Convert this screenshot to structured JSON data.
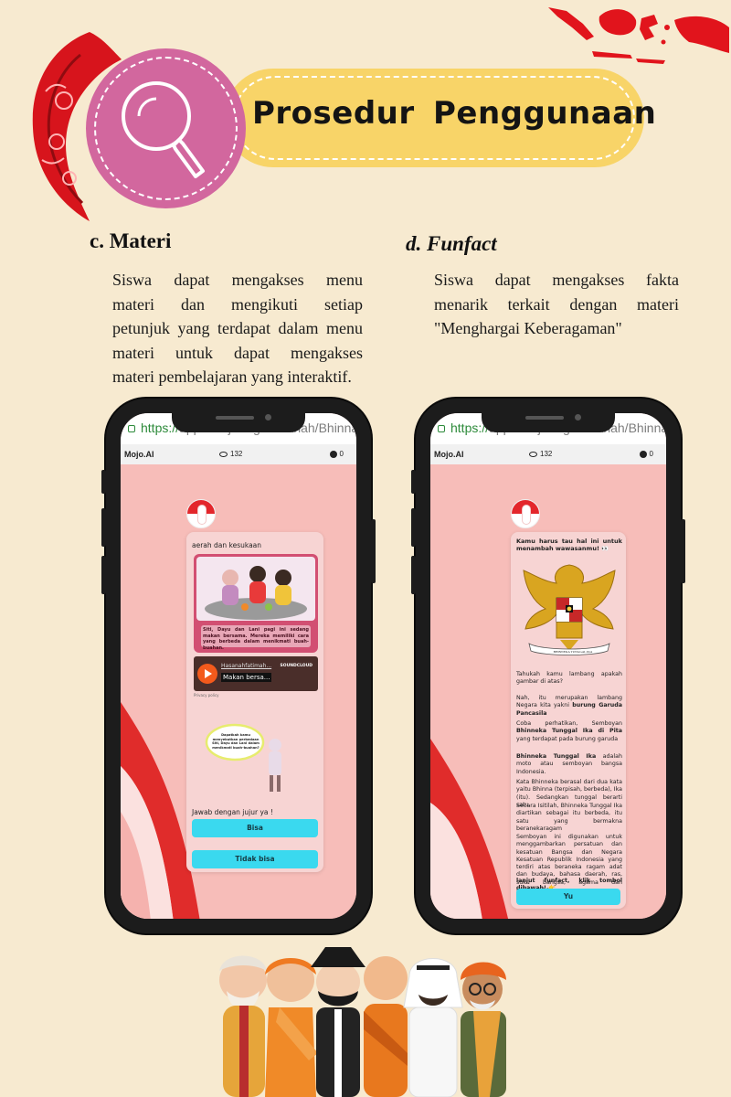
{
  "header": {
    "title": "Prosedur  Penggunaan",
    "search_icon": "magnifier-icon",
    "colors": {
      "banner": "#f8d468",
      "circle": "#d2679e",
      "ornament": "#d7141c",
      "map": "#e1141c"
    }
  },
  "sections": {
    "left": {
      "title": "c. Materi",
      "lines": [
        "Siswa dapat mengakses menu",
        "materi dan mengikuti setiap",
        "petunjuk yang terdapat dalam menu",
        "materi untuk dapat mengakses",
        "materi pembelajaran yang interaktif."
      ]
    },
    "right": {
      "title": "d. Funfact",
      "lines": [
        "Siswa dapat mengakses fakta",
        "menarik terkait dengan materi",
        "\"Menghargai Keberagaman\""
      ]
    }
  },
  "phone_left": {
    "url_https": "https://",
    "url_rest": "app.smojo.org/Hasanah/Bhinna",
    "logo": "Mojo.AI",
    "views": "132",
    "comments": "0",
    "card_caption": "aerah dan kesukaan",
    "comic_text": "Siti, Dayu dan Lani pagi ini sedang makan bersama. Mereka memiliki cara yang berbeda dalam menikmati buah-buahan.",
    "player_link": "Hasanahfatimah...",
    "player_title": "Makan bersa...",
    "player_brand": "SOUNDCLOUD",
    "player_privacy": "Privacy policy",
    "bubble_text": "Dapatkah kamu menyebutkan perbedaan Siti, Dayu dan Lani dalam menikmati buah-buahan?",
    "prompt": "Jawab dengan jujur ya !",
    "btn_yes": "Bisa",
    "btn_no": "Tidak bisa"
  },
  "phone_right": {
    "url_https": "https://",
    "url_rest": "app.smojo.org/Hasanah/Bhinna",
    "logo": "Mojo.AI",
    "views": "132",
    "comments": "0",
    "intro": "Kamu harus tau hal ini untuk menambah wawasanmu! 👀",
    "emblem_motto": "BHINNEKA TUNGGAL IKA",
    "para1": "Tahukah kamu lambang apakah gambar di atas?",
    "para2_a": "Nah, itu merupakan lambang Negara kita yakni ",
    "para2_b": "burung Garuda Pancasila",
    "para3_a": "Coba perhatikan, Semboyan ",
    "para3_b": "Bhinneka Tunggal Ika di Pita",
    "para3_c": " yang terdapat pada burung garuda",
    "para4_a": "Bhinneka Tunggal Ika",
    "para4_b": " adalah moto atau semboyan bangsa Indonesia.",
    "para5": "Kata Bhinneka berasal dari dua kata yaitu Bhinna (terpisah, berbeda), Ika (itu). Sedangkan tunggal berarti satu.",
    "para6": "Secara Isitilah, Bhinneka Tunggal Ika diartikan sebagai itu berbeda, itu satu yang bermakna beranekaragam",
    "para7": "Semboyan ini digunakan untuk menggambarkan persatuan dan kesatuan Bangsa dan Negara Kesatuan Republik Indonesia yang terdiri atas beraneka ragam adat dan budaya, bahasa daerah, ras, suku bangsa, agama dan kepercayaan.",
    "para8": "lanjut funfact, klik tombol dibawah! 👉",
    "btn": "Yu"
  },
  "footer": {
    "illustration": "diverse-people-group"
  }
}
